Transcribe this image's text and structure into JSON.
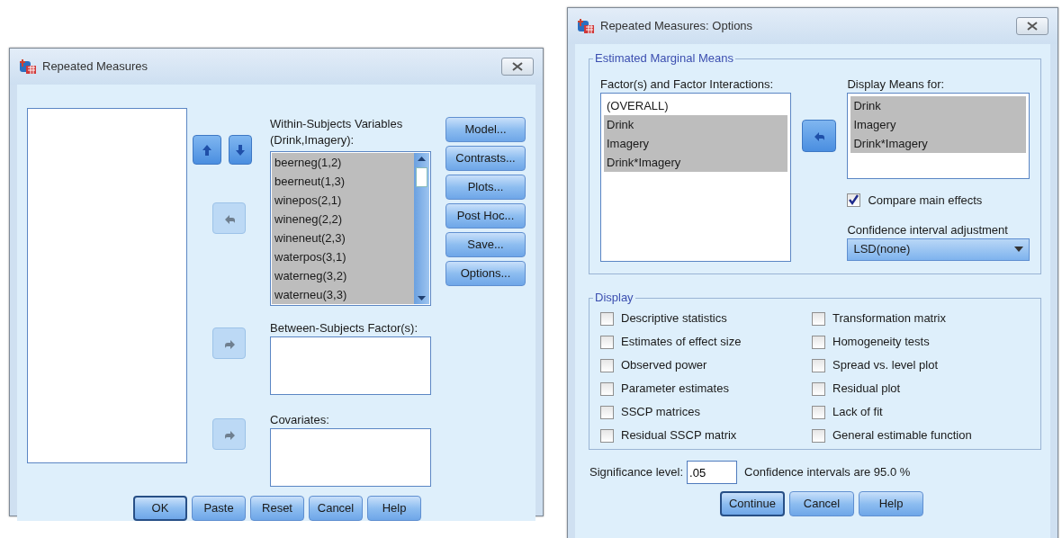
{
  "main_dialog": {
    "title": "Repeated Measures",
    "order_buttons": [
      {
        "kind": "up",
        "disabled": false
      },
      {
        "kind": "down",
        "disabled": false
      }
    ],
    "within_subjects": {
      "label": "Within-Subjects Variables (Drink,Imagery):",
      "move_button": {
        "disabled": true
      },
      "items": [
        {
          "text": "beerneg(1,2)",
          "selected": true
        },
        {
          "text": "beerneut(1,3)",
          "selected": true
        },
        {
          "text": "winepos(2,1)",
          "selected": true
        },
        {
          "text": "wineneg(2,2)",
          "selected": true
        },
        {
          "text": "wineneut(2,3)",
          "selected": true
        },
        {
          "text": "waterpos(3,1)",
          "selected": true
        },
        {
          "text": "waterneg(3,2)",
          "selected": true
        },
        {
          "text": "waterneu(3,3)",
          "selected": true
        }
      ]
    },
    "between_subjects": {
      "label": "Between-Subjects Factor(s):",
      "move_button": {
        "disabled": true
      }
    },
    "covariates": {
      "label": "Covariates:",
      "move_button": {
        "disabled": true
      }
    },
    "side_buttons": [
      {
        "label": "Model...",
        "default": false
      },
      {
        "label": "Contrasts...",
        "default": false
      },
      {
        "label": "Plots...",
        "default": false
      },
      {
        "label": "Post Hoc...",
        "default": false
      },
      {
        "label": "Save...",
        "default": false
      },
      {
        "label": "Options...",
        "default": false
      }
    ],
    "bottom_buttons": [
      {
        "label": "OK",
        "default": true
      },
      {
        "label": "Paste",
        "default": false
      },
      {
        "label": "Reset",
        "default": false
      },
      {
        "label": "Cancel",
        "default": false
      },
      {
        "label": "Help",
        "default": false
      }
    ]
  },
  "options_dialog": {
    "title": "Repeated Measures: Options",
    "estimated_marginal_means": {
      "legend": "Estimated Marginal Means",
      "factors": {
        "label": "Factor(s) and Factor Interactions:",
        "items": [
          {
            "text": "(OVERALL)",
            "selected": false
          },
          {
            "text": "Drink",
            "selected": true
          },
          {
            "text": "Imagery",
            "selected": true
          },
          {
            "text": "Drink*Imagery",
            "selected": true
          }
        ]
      },
      "move_button": {
        "disabled": false
      },
      "display_means": {
        "label": "Display Means for:",
        "items": [
          {
            "text": "Drink",
            "selected": true
          },
          {
            "text": "Imagery",
            "selected": true
          },
          {
            "text": "Drink*Imagery",
            "selected": true
          }
        ]
      },
      "compare_main_effects": {
        "label": "Compare main effects",
        "checked": true
      },
      "ci_adjustment": {
        "label": "Confidence interval adjustment",
        "value": "LSD(none)"
      }
    },
    "display": {
      "legend": "Display",
      "options": [
        {
          "label": "Descriptive statistics",
          "checked": false
        },
        {
          "label": "Estimates of effect size",
          "checked": false
        },
        {
          "label": "Observed power",
          "checked": false
        },
        {
          "label": "Parameter estimates",
          "checked": false
        },
        {
          "label": "SSCP matrices",
          "checked": false
        },
        {
          "label": "Residual SSCP matrix",
          "checked": false
        },
        {
          "label": "Transformation matrix",
          "checked": false
        },
        {
          "label": "Homogeneity tests",
          "checked": false
        },
        {
          "label": "Spread vs. level plot",
          "checked": false
        },
        {
          "label": "Residual plot",
          "checked": false
        },
        {
          "label": "Lack of fit",
          "checked": false
        },
        {
          "label": "General estimable function",
          "checked": false
        }
      ]
    },
    "significance": {
      "label": "Significance level:",
      "value": ".05"
    },
    "confidence_note": "Confidence intervals are 95.0 %",
    "buttons": [
      {
        "label": "Continue",
        "default": true
      },
      {
        "label": "Cancel",
        "default": false
      },
      {
        "label": "Help",
        "default": false
      }
    ]
  }
}
